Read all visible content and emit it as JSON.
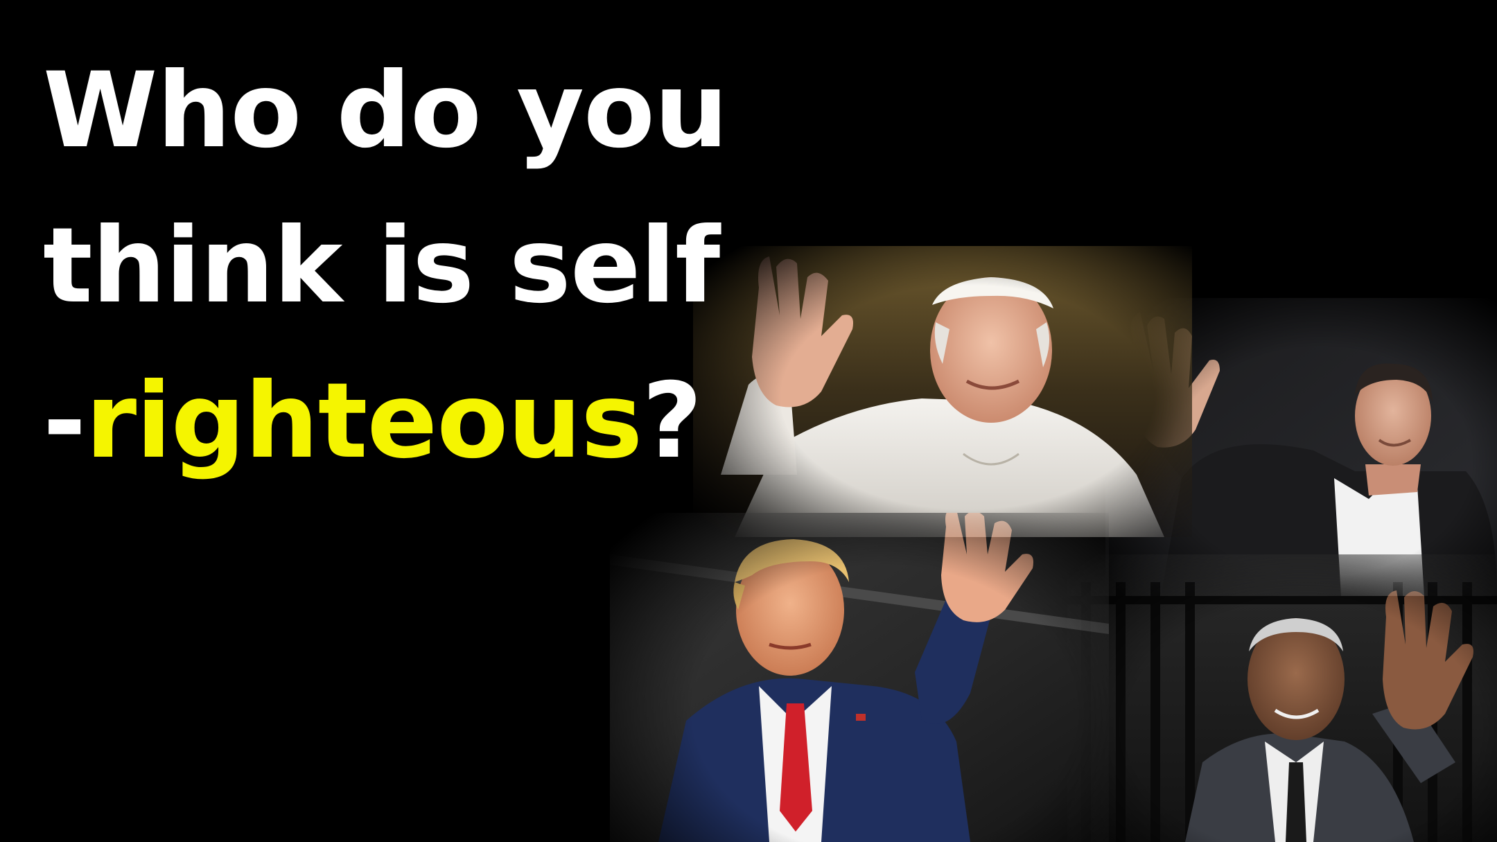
{
  "headline": {
    "line1": "Who do you",
    "line2": "think is self",
    "line3_prefix": "-",
    "line3_highlight": "righteous",
    "line3_suffix": "?"
  },
  "colors": {
    "background": "#000000",
    "text": "#ffffff",
    "highlight": "#f5f500"
  }
}
